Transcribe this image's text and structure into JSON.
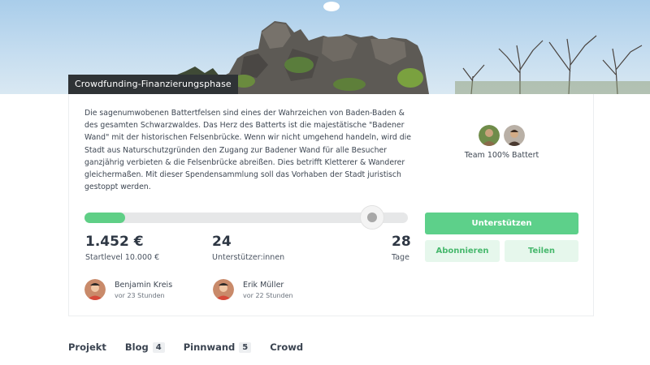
{
  "hero": {
    "phase_badge": "Crowdfunding-Finanzierungsphase"
  },
  "description": "Die sagenumwobenen Battertfelsen sind eines der Wahrzeichen von Baden-Baden & des gesamten Schwarzwaldes. Das Herz des Batterts ist die majestätische \"Badener Wand\" mit der historischen Felsenbrücke. Wenn wir nicht umgehend handeln, wird die Stadt aus Naturschutzgründen den Zugang zur Badener Wand für alle Besucher ganzjährig verbieten & die Felsenbrücke abreißen. Dies betrifft Kletterer & Wanderer gleichermaßen. Mit dieser Spendensammlung soll das Vorhaben der Stadt juristisch gestoppt werden.",
  "team": {
    "name": "Team 100% Battert"
  },
  "progress": {
    "fraction": 0.126,
    "marker_fraction": 0.88
  },
  "stats": {
    "amount": "1.452 €",
    "amount_label": "Startlevel 10.000 €",
    "supporters": "24",
    "supporters_label": "Unterstützer:innen",
    "days": "28",
    "days_label": "Tage"
  },
  "actions": {
    "support": "Unterstützen",
    "subscribe": "Abonnieren",
    "share": "Teilen"
  },
  "recent_supporters": [
    {
      "name": "Benjamin Kreis",
      "time": "vor 23 Stunden"
    },
    {
      "name": "Erik Müller",
      "time": "vor 22 Stunden"
    }
  ],
  "tabs": [
    {
      "label": "Projekt",
      "count": ""
    },
    {
      "label": "Blog",
      "count": "4"
    },
    {
      "label": "Pinnwand",
      "count": "5"
    },
    {
      "label": "Crowd",
      "count": ""
    }
  ],
  "colors": {
    "accent": "#5dd08a",
    "accent_light": "#e6f7ec",
    "badge_bg": "#2f3336"
  }
}
